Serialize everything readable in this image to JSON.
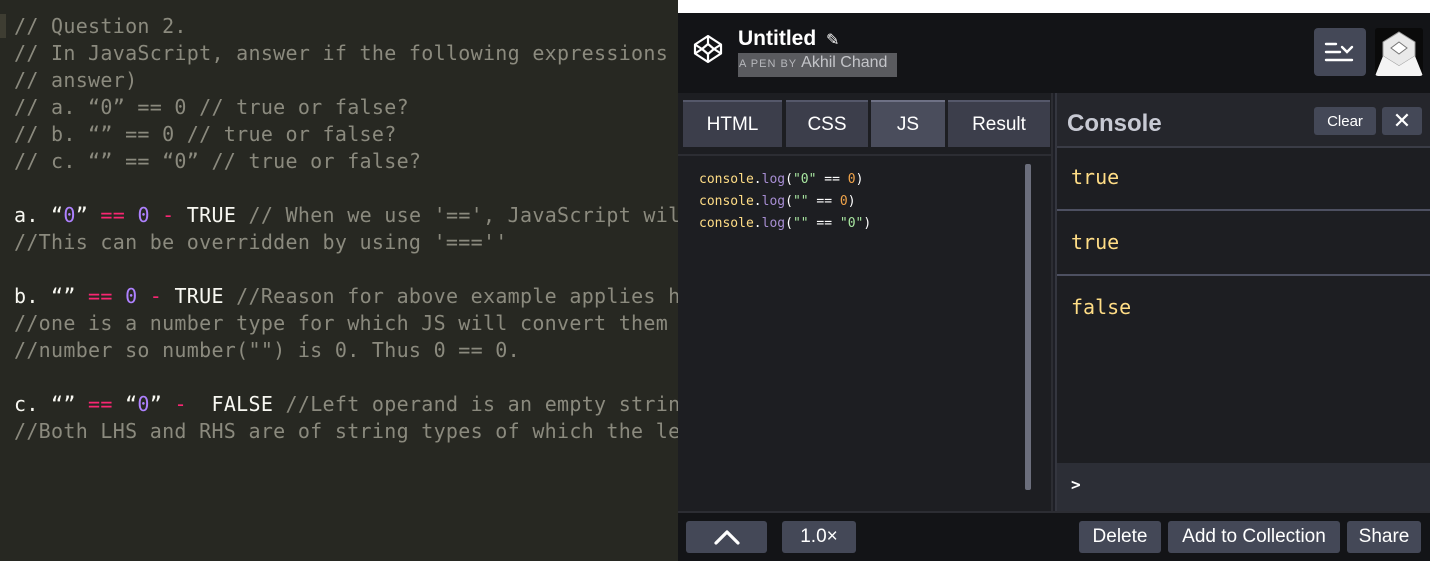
{
  "editor": {
    "lines": [
      [
        {
          "t": "// Question 2.",
          "c": "comment"
        }
      ],
      [
        {
          "t": "// In JavaScript, answer if the following expressions",
          "c": "comment"
        }
      ],
      [
        {
          "t": "// answer)",
          "c": "comment"
        }
      ],
      [
        {
          "t": "// a. “0” == 0 // true or false?",
          "c": "comment"
        }
      ],
      [
        {
          "t": "// b. “” == 0 // true or false?",
          "c": "comment"
        }
      ],
      [
        {
          "t": "// c. “” == “0” // true or false?",
          "c": "comment"
        }
      ],
      [],
      [
        {
          "t": "a. “",
          "c": "plain"
        },
        {
          "t": "0",
          "c": "num"
        },
        {
          "t": "” ",
          "c": "plain"
        },
        {
          "t": "==",
          "c": "op"
        },
        {
          "t": " ",
          "c": "plain"
        },
        {
          "t": "0",
          "c": "num"
        },
        {
          "t": " ",
          "c": "plain"
        },
        {
          "t": "-",
          "c": "op"
        },
        {
          "t": " TRUE ",
          "c": "plain"
        },
        {
          "t": "// When we use '==', JavaScript wil",
          "c": "comment"
        }
      ],
      [
        {
          "t": "//This can be overridden by using '===''",
          "c": "comment"
        }
      ],
      [],
      [
        {
          "t": "b. “” ",
          "c": "plain"
        },
        {
          "t": "==",
          "c": "op"
        },
        {
          "t": " ",
          "c": "plain"
        },
        {
          "t": "0",
          "c": "num"
        },
        {
          "t": " ",
          "c": "plain"
        },
        {
          "t": "-",
          "c": "op"
        },
        {
          "t": " TRUE ",
          "c": "plain"
        },
        {
          "t": "//Reason for above example applies h",
          "c": "comment"
        }
      ],
      [
        {
          "t": "//one is a number type for which JS will convert them",
          "c": "comment"
        }
      ],
      [
        {
          "t": "//number so number(\"\") is 0. Thus 0 == 0.",
          "c": "comment"
        }
      ],
      [],
      [
        {
          "t": "c. “” ",
          "c": "plain"
        },
        {
          "t": "==",
          "c": "op"
        },
        {
          "t": " “",
          "c": "plain"
        },
        {
          "t": "0",
          "c": "num"
        },
        {
          "t": "” ",
          "c": "plain"
        },
        {
          "t": "-",
          "c": "op"
        },
        {
          "t": "  FALSE ",
          "c": "plain"
        },
        {
          "t": "//Left operand is an empty strin",
          "c": "comment"
        }
      ],
      [
        {
          "t": "//Both LHS and RHS are of string types of which the le",
          "c": "comment"
        }
      ]
    ]
  },
  "pen": {
    "title": "Untitled",
    "edit_icon": "✎",
    "byline_prefix": "A PEN BY",
    "author": "Akhil Chand",
    "tabs": [
      "HTML",
      "CSS",
      "JS",
      "Result"
    ],
    "active_tab": "JS",
    "code": [
      [
        {
          "t": "console",
          "c": "obj"
        },
        {
          "t": ".",
          "c": "plain"
        },
        {
          "t": "log",
          "c": "method"
        },
        {
          "t": "(",
          "c": "plain"
        },
        {
          "t": "\"0\"",
          "c": "str"
        },
        {
          "t": " == ",
          "c": "plain"
        },
        {
          "t": "0",
          "c": "num"
        },
        {
          "t": ")",
          "c": "plain"
        }
      ],
      [
        {
          "t": "console",
          "c": "obj"
        },
        {
          "t": ".",
          "c": "plain"
        },
        {
          "t": "log",
          "c": "method"
        },
        {
          "t": "(",
          "c": "plain"
        },
        {
          "t": "\"\"",
          "c": "str"
        },
        {
          "t": " == ",
          "c": "plain"
        },
        {
          "t": "0",
          "c": "num"
        },
        {
          "t": ")",
          "c": "plain"
        }
      ],
      [
        {
          "t": "console",
          "c": "obj"
        },
        {
          "t": ".",
          "c": "plain"
        },
        {
          "t": "log",
          "c": "method"
        },
        {
          "t": "(",
          "c": "plain"
        },
        {
          "t": "\"\"",
          "c": "str"
        },
        {
          "t": " == ",
          "c": "plain"
        },
        {
          "t": "\"0\"",
          "c": "str"
        },
        {
          "t": ")",
          "c": "plain"
        }
      ]
    ],
    "console": {
      "title": "Console",
      "clear_label": "Clear",
      "close_glyph": "✕",
      "entries": [
        "true",
        "true",
        "false"
      ],
      "prompt": ">"
    },
    "footer": {
      "collapse_glyph": "︿",
      "zoom": "1.0×",
      "delete": "Delete",
      "add_to_collection": "Add to Collection",
      "share": "Share"
    }
  },
  "colors": {
    "editor_bg": "#272822",
    "comment": "#8b8a7e",
    "operator": "#f92672",
    "number": "#ae81ff",
    "console_value": "#ffdd86",
    "codepen_dark": "#131417",
    "button_gray": "#444857"
  }
}
